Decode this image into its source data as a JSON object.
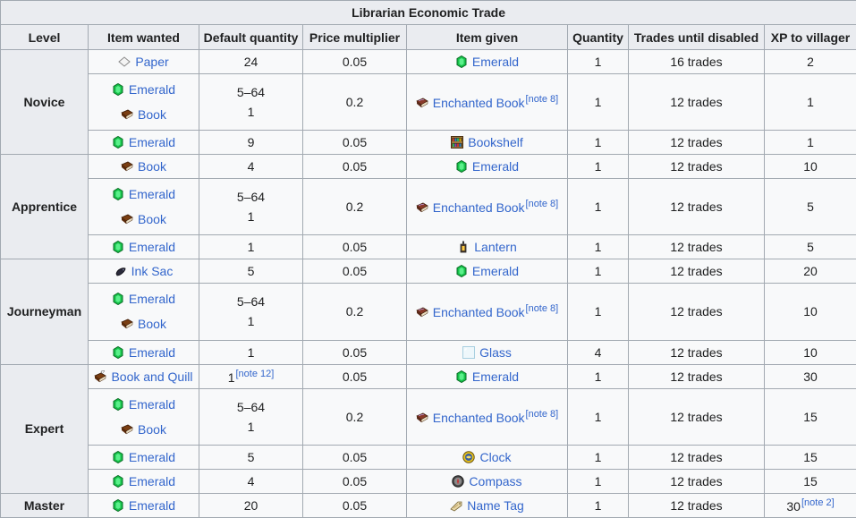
{
  "table": {
    "title": "Librarian Economic Trade",
    "headers": [
      "Level",
      "Item wanted",
      "Default quantity",
      "Price multiplier",
      "Item given",
      "Quantity",
      "Trades until disabled",
      "XP to villager"
    ]
  },
  "icons": {
    "emerald": "emerald-icon",
    "paper": "paper-icon",
    "book": "book-icon",
    "enchanted_book": "enchanted-book-icon",
    "bookshelf": "bookshelf-icon",
    "lantern": "lantern-icon",
    "ink_sac": "ink-sac-icon",
    "glass": "glass-icon",
    "book_and_quill": "book-and-quill-icon",
    "clock": "clock-icon",
    "compass": "compass-icon",
    "name_tag": "name-tag-icon"
  },
  "colors": {
    "link": "#3366cc",
    "header_bg": "#eaecf0",
    "cell_bg": "#f8f9fa",
    "border": "#a2a9b1"
  },
  "levels": {
    "novice": "Novice",
    "apprentice": "Apprentice",
    "journeyman": "Journeyman",
    "expert": "Expert",
    "master": "Master"
  },
  "rows": [
    {
      "wanted1": "Paper",
      "qty": "24",
      "mult": "0.05",
      "given": "Emerald",
      "gqty": "1",
      "trades": "16 trades",
      "xp": "2"
    },
    {
      "wanted1": "Emerald",
      "wanted2": "Book",
      "qty1": "5–64",
      "qty2": "1",
      "mult": "0.2",
      "given": "Enchanted Book",
      "note": "[note 8]",
      "gqty": "1",
      "trades": "12 trades",
      "xp": "1"
    },
    {
      "wanted1": "Emerald",
      "qty": "9",
      "mult": "0.05",
      "given": "Bookshelf",
      "gqty": "1",
      "trades": "12 trades",
      "xp": "1"
    },
    {
      "wanted1": "Book",
      "qty": "4",
      "mult": "0.05",
      "given": "Emerald",
      "gqty": "1",
      "trades": "12 trades",
      "xp": "10"
    },
    {
      "wanted1": "Emerald",
      "wanted2": "Book",
      "qty1": "5–64",
      "qty2": "1",
      "mult": "0.2",
      "given": "Enchanted Book",
      "note": "[note 8]",
      "gqty": "1",
      "trades": "12 trades",
      "xp": "5"
    },
    {
      "wanted1": "Emerald",
      "qty": "1",
      "mult": "0.05",
      "given": "Lantern",
      "gqty": "1",
      "trades": "12 trades",
      "xp": "5"
    },
    {
      "wanted1": "Ink Sac",
      "qty": "5",
      "mult": "0.05",
      "given": "Emerald",
      "gqty": "1",
      "trades": "12 trades",
      "xp": "20"
    },
    {
      "wanted1": "Emerald",
      "wanted2": "Book",
      "qty1": "5–64",
      "qty2": "1",
      "mult": "0.2",
      "given": "Enchanted Book",
      "note": "[note 8]",
      "gqty": "1",
      "trades": "12 trades",
      "xp": "10"
    },
    {
      "wanted1": "Emerald",
      "qty": "1",
      "mult": "0.05",
      "given": "Glass",
      "gqty": "4",
      "trades": "12 trades",
      "xp": "10"
    },
    {
      "wanted1": "Book and Quill",
      "qty": "1",
      "qty_note": "[note 12]",
      "mult": "0.05",
      "given": "Emerald",
      "gqty": "1",
      "trades": "12 trades",
      "xp": "30"
    },
    {
      "wanted1": "Emerald",
      "wanted2": "Book",
      "qty1": "5–64",
      "qty2": "1",
      "mult": "0.2",
      "given": "Enchanted Book",
      "note": "[note 8]",
      "gqty": "1",
      "trades": "12 trades",
      "xp": "15"
    },
    {
      "wanted1": "Emerald",
      "qty": "5",
      "mult": "0.05",
      "given": "Clock",
      "gqty": "1",
      "trades": "12 trades",
      "xp": "15"
    },
    {
      "wanted1": "Emerald",
      "qty": "4",
      "mult": "0.05",
      "given": "Compass",
      "gqty": "1",
      "trades": "12 trades",
      "xp": "15"
    },
    {
      "wanted1": "Emerald",
      "qty": "20",
      "mult": "0.05",
      "given": "Name Tag",
      "gqty": "1",
      "trades": "12 trades",
      "xp": "30",
      "xp_note": "[note 2]"
    }
  ]
}
